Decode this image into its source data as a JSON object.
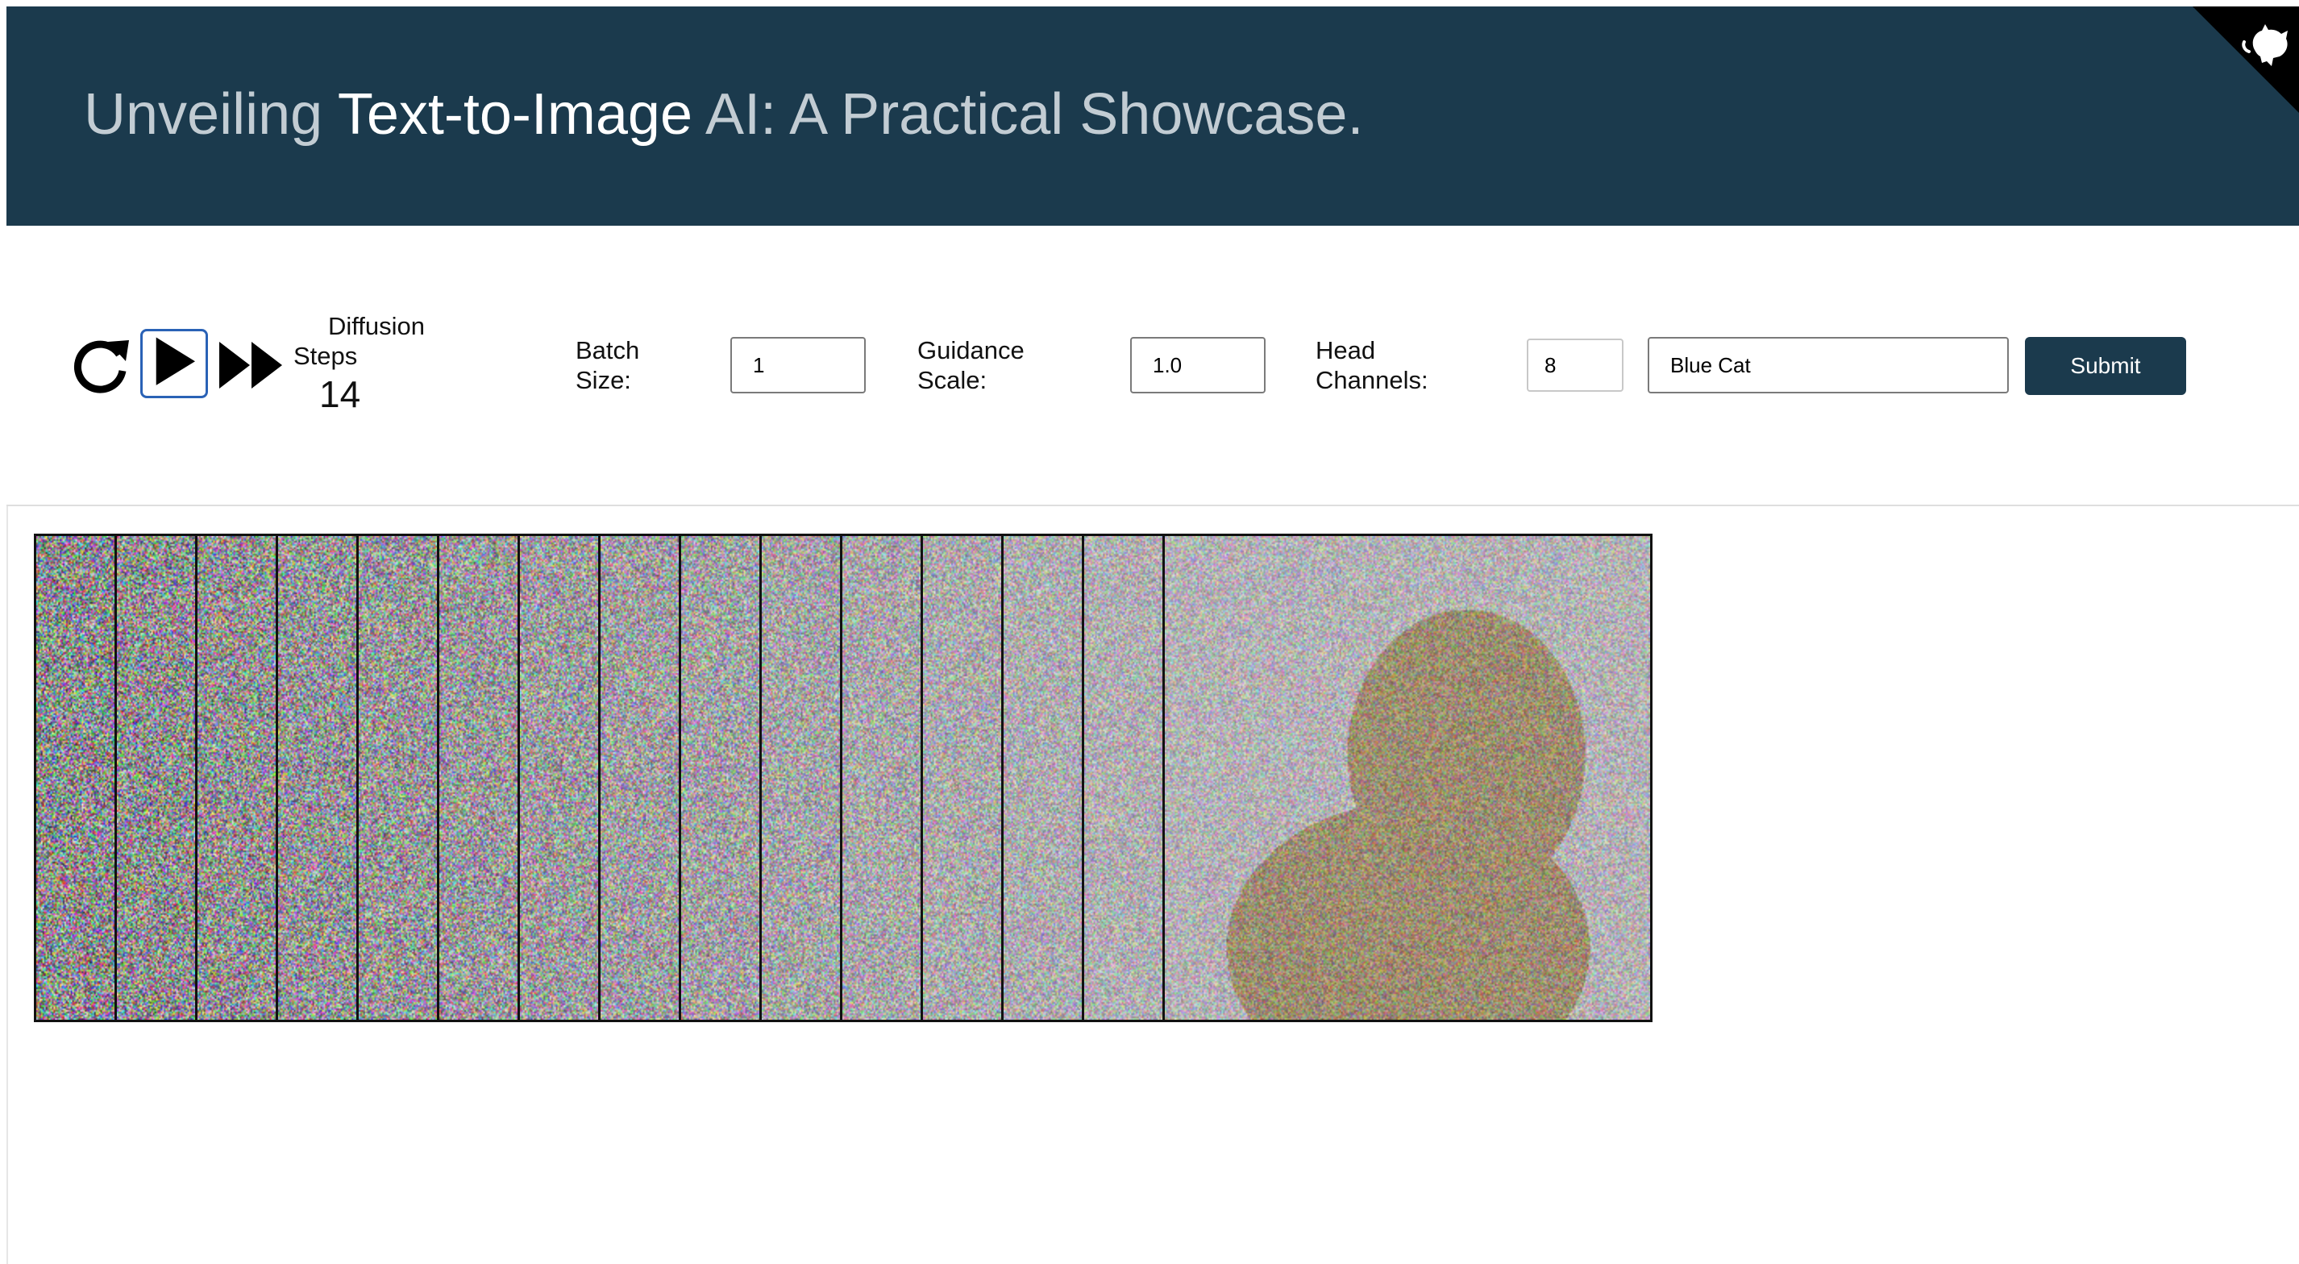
{
  "header": {
    "title_pre": "Unveiling ",
    "title_highlight": "Text-to-Image",
    "title_post": " AI: A Practical Showcase.",
    "bg_color": "#1b3a4d",
    "corner_icon": "octocat-icon"
  },
  "controls": {
    "reset_icon": "reset-icon",
    "play_icon": "play-icon",
    "fast_forward_icon": "fast-forward-icon",
    "diffusion_steps": {
      "label_line1": "Diffusion",
      "label_line2": "Steps",
      "value": "14"
    },
    "batch_size": {
      "label_line1": "Batch",
      "label_line2": "Size:",
      "value": "1"
    },
    "guidance_scale": {
      "label_line1": "Guidance",
      "label_line2": "Scale:",
      "value": "1.0"
    },
    "head_channels": {
      "label_line1": "Head",
      "label_line2": "Channels:",
      "value": "8"
    },
    "prompt": {
      "value": "Blue Cat"
    },
    "submit_label": "Submit"
  },
  "diffusion_strip": {
    "frame_count": 15,
    "description_colors": {
      "noise_light": "#cfc8cf",
      "noise_dark": "#5a5570",
      "subject": "#b8935c"
    }
  }
}
